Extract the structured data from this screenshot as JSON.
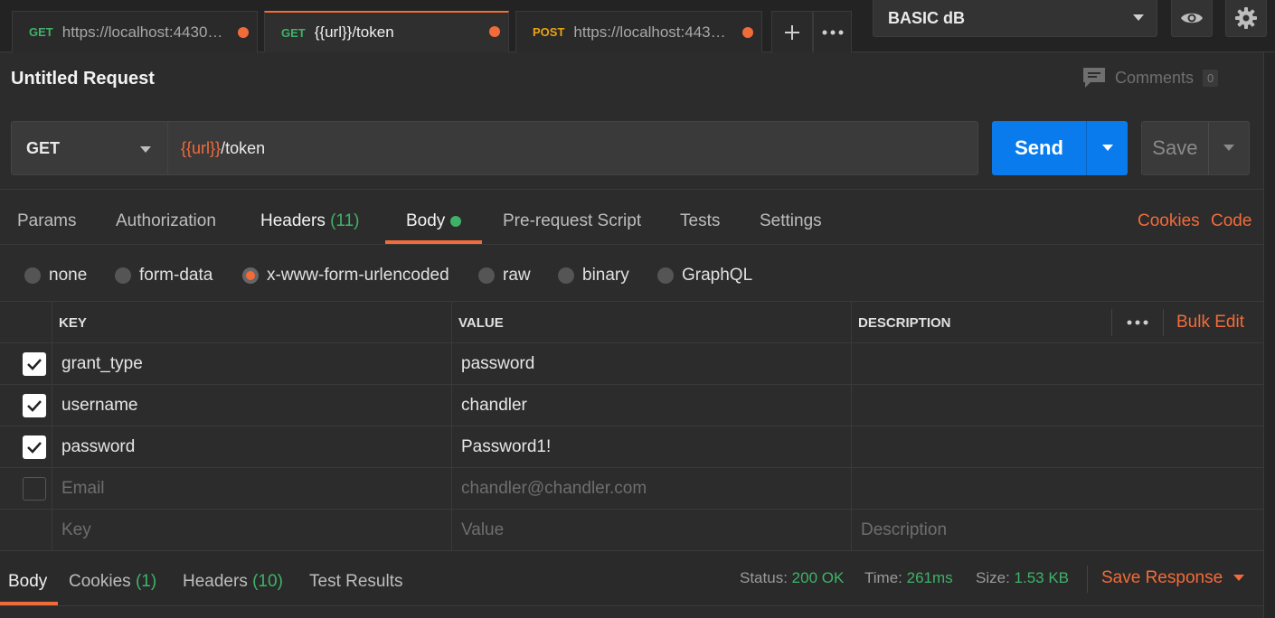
{
  "tabs": [
    {
      "method": "GET",
      "url": "https://localhost:44304/...",
      "unsaved": true
    },
    {
      "method": "GET",
      "url": "{{url}}/token",
      "unsaved": true,
      "active": true
    },
    {
      "method": "POST",
      "url": "https://localhost:44304...",
      "unsaved": true
    }
  ],
  "tab_actions": {
    "add_icon": "plus-icon",
    "more_icon": "ellipsis-icon"
  },
  "environment": {
    "selected": "BASIC dB",
    "eye_icon": "eye-icon",
    "settings_icon": "gear-icon"
  },
  "request": {
    "title": "Untitled Request",
    "comments_label": "Comments",
    "comments_count": "0",
    "method": "GET",
    "url_var": "{{url}}",
    "url_path": "/token",
    "send_label": "Send",
    "save_label": "Save"
  },
  "request_tabs": [
    {
      "label": "Params"
    },
    {
      "label": "Authorization"
    },
    {
      "label": "Headers",
      "count": "(11)"
    },
    {
      "label": "Body",
      "active": true
    },
    {
      "label": "Pre-request Script"
    },
    {
      "label": "Tests"
    },
    {
      "label": "Settings"
    }
  ],
  "right_links": {
    "cookies": "Cookies",
    "code": "Code"
  },
  "body_types": [
    {
      "label": "none"
    },
    {
      "label": "form-data"
    },
    {
      "label": "x-www-form-urlencoded",
      "checked": true
    },
    {
      "label": "raw"
    },
    {
      "label": "binary"
    },
    {
      "label": "GraphQL"
    }
  ],
  "table": {
    "headers": {
      "key": "KEY",
      "value": "VALUE",
      "description": "DESCRIPTION"
    },
    "bulk_edit": "Bulk Edit",
    "rows": [
      {
        "checked": true,
        "key": "grant_type",
        "value": "password",
        "description": ""
      },
      {
        "checked": true,
        "key": "username",
        "value": "chandler",
        "description": ""
      },
      {
        "checked": true,
        "key": "password",
        "value": "Password1!",
        "description": ""
      },
      {
        "checked": false,
        "key": "Email",
        "value": "chandler@chandler.com",
        "description": ""
      }
    ],
    "placeholders": {
      "key": "Key",
      "value": "Value",
      "description": "Description"
    }
  },
  "response": {
    "tabs": [
      {
        "label": "Body",
        "active": true
      },
      {
        "label": "Cookies",
        "count": "(1)"
      },
      {
        "label": "Headers",
        "count": "(10)"
      },
      {
        "label": "Test Results"
      }
    ],
    "status_label": "Status:",
    "status_value": "200 OK",
    "time_label": "Time:",
    "time_value": "261ms",
    "size_label": "Size:",
    "size_value": "1.53 KB",
    "save_label": "Save Response"
  },
  "colors": {
    "accent": "#f26b3a",
    "send": "#097bed",
    "get": "#3eb368",
    "post": "#e8a317"
  }
}
